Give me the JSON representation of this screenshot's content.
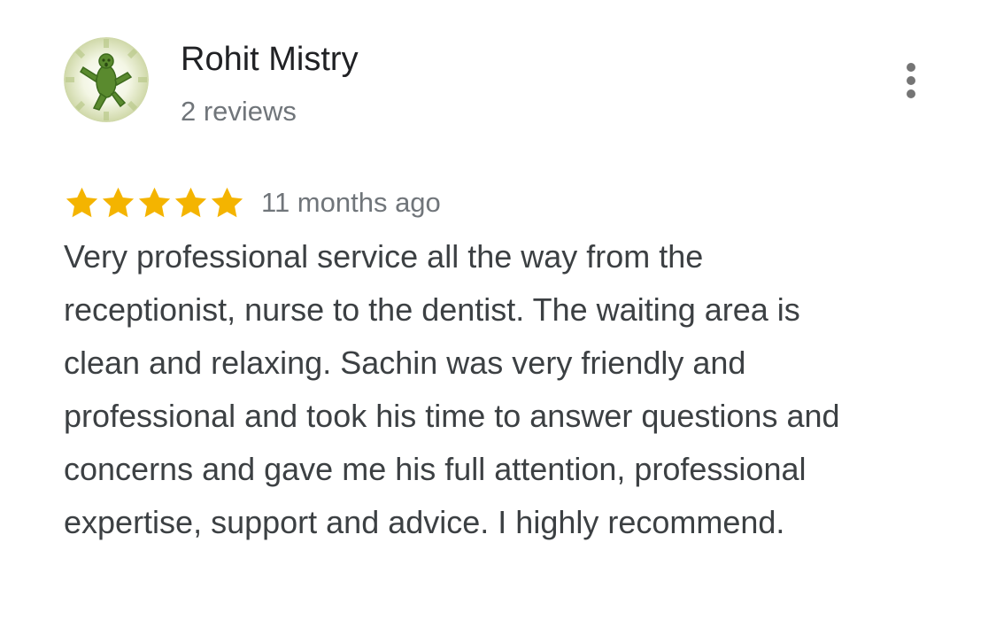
{
  "reviewer": {
    "name": "Rohit Mistry",
    "review_count": "2 reviews",
    "avatar_icon": "cactuar-avatar-icon"
  },
  "menu": {
    "icon": "more-vert-icon"
  },
  "review": {
    "rating": 5,
    "rating_max": 5,
    "star_color": "#f4b400",
    "date": "11 months ago",
    "text": "Very professional service all the way from the receptionist, nurse to the dentist. The waiting area is clean and relaxing. Sachin was very friendly and professional and took his time to answer questions and concerns and gave me his full attention, professional expertise, support and advice. I highly recommend."
  }
}
